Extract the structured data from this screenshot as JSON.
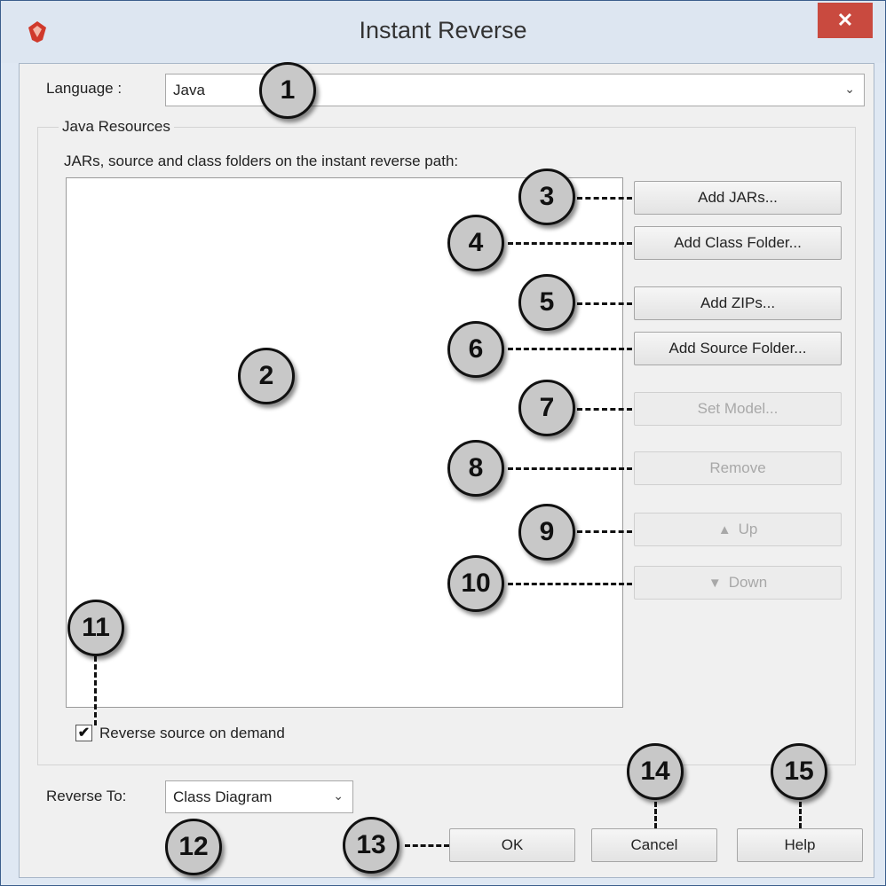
{
  "window": {
    "title": "Instant Reverse",
    "close_glyph": "✕",
    "app_icon": "visual-paradigm-logo-icon"
  },
  "language": {
    "label": "Language :",
    "value": "Java"
  },
  "group": {
    "title": "Java Resources",
    "path_label": "JARs, source and class folders on the instant reverse path:"
  },
  "buttons": {
    "add_jars": "Add JARs...",
    "add_class_folder": "Add Class Folder...",
    "add_zips": "Add ZIPs...",
    "add_source_folder": "Add Source Folder...",
    "set_model": "Set Model...",
    "remove": "Remove",
    "up": "Up",
    "down": "Down",
    "ok": "OK",
    "cancel": "Cancel",
    "help": "Help"
  },
  "checkbox": {
    "label": "Reverse source on demand",
    "checked": true
  },
  "reverse_to": {
    "label": "Reverse To:",
    "value": "Class Diagram"
  },
  "callouts": [
    "1",
    "2",
    "3",
    "4",
    "5",
    "6",
    "7",
    "8",
    "9",
    "10",
    "11",
    "12",
    "13",
    "14",
    "15"
  ],
  "colors": {
    "close_button": "#c94a3f",
    "callout_fill": "#c8c8c8",
    "window_frame": "#dfe8f3"
  }
}
